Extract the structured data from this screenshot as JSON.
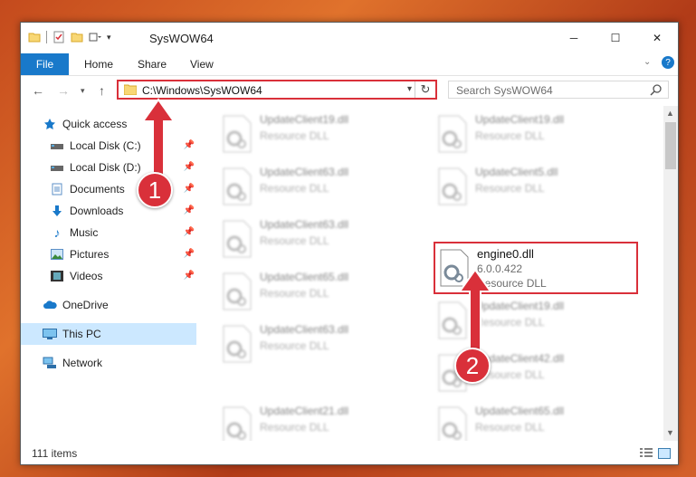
{
  "window": {
    "title": "SysWOW64",
    "controls": {
      "minimize": "─",
      "maximize": "☐",
      "close": "✕"
    }
  },
  "ribbon": {
    "file_tab": "File",
    "tabs": [
      "Home",
      "Share",
      "View"
    ]
  },
  "address": {
    "path": "C:\\Windows\\SysWOW64",
    "dropdown_icon": "chevron-down-icon",
    "refresh_icon": "refresh-icon"
  },
  "search": {
    "placeholder": "Search SysWOW64"
  },
  "sidebar": {
    "items": [
      {
        "label": "Quick access",
        "icon": "star-icon",
        "pinned": false
      },
      {
        "label": "Local Disk (C:)",
        "icon": "drive-icon",
        "pinned": true
      },
      {
        "label": "Local Disk (D:)",
        "icon": "drive-icon",
        "pinned": true
      },
      {
        "label": "Documents",
        "icon": "document-icon",
        "pinned": true
      },
      {
        "label": "Downloads",
        "icon": "download-icon",
        "pinned": true
      },
      {
        "label": "Music",
        "icon": "music-icon",
        "pinned": true
      },
      {
        "label": "Pictures",
        "icon": "picture-icon",
        "pinned": true
      },
      {
        "label": "Videos",
        "icon": "video-icon",
        "pinned": true
      },
      {
        "label": "OneDrive",
        "icon": "cloud-icon",
        "pinned": false
      },
      {
        "label": "This PC",
        "icon": "computer-icon",
        "pinned": false,
        "selected": true
      },
      {
        "label": "Network",
        "icon": "network-icon",
        "pinned": false
      }
    ]
  },
  "files": [
    {
      "name": "UpdateClient19.dll",
      "type": "Resource DLL"
    },
    {
      "name": "UpdateClient19.dll",
      "type": "Resource DLL"
    },
    {
      "name": "UpdateClient63.dll",
      "type": "Resource DLL"
    },
    {
      "name": "UpdateClient5.dll",
      "type": "Resource DLL"
    },
    {
      "name": "UpdateClient63.dll",
      "type": "Resource DLL"
    },
    {
      "name": "engine0.dll",
      "version": "6.0.0.422",
      "type": "Resource DLL",
      "highlighted": true
    },
    {
      "name": "UpdateClient65.dll",
      "type": "Resource DLL"
    },
    {
      "name": "UpdateClient19.dll",
      "type": "Resource DLL"
    },
    {
      "name": "UpdateClient63.dll",
      "type": "Resource DLL"
    },
    {
      "name": "UpdateClient42.dll",
      "type": "Resource DLL"
    },
    {
      "name": "UpdateClient21.dll",
      "type": "Resource DLL"
    },
    {
      "name": "UpdateClient65.dll",
      "type": "Resource DLL"
    }
  ],
  "status": {
    "item_count": "111 items"
  },
  "annotations": {
    "step1": "1",
    "step2": "2"
  },
  "colors": {
    "accent": "#1979ca",
    "highlight": "#d9303a",
    "selected": "#cce8ff"
  }
}
